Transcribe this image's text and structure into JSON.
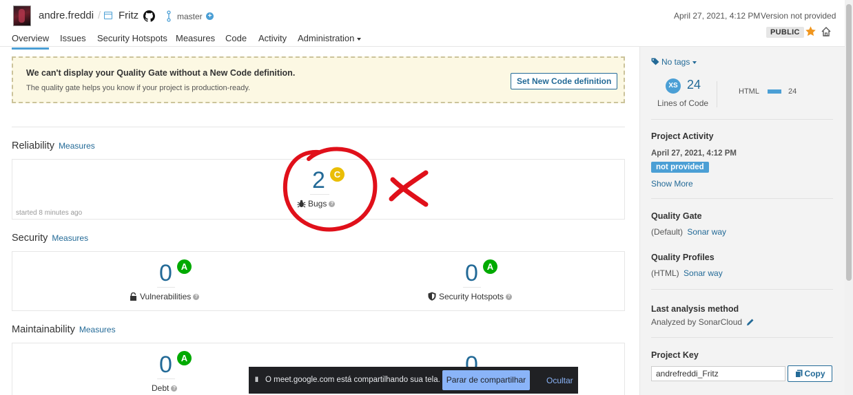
{
  "header": {
    "org": "andre.freddi",
    "separator": "/",
    "project": "Fritz",
    "branch": "master",
    "branch_add": "+",
    "analysis_date": "April 27, 2021, 4:12 PM",
    "version": "Version not provided",
    "visibility": "PUBLIC",
    "nav": [
      {
        "label": "Overview",
        "active": true
      },
      {
        "label": "Issues"
      },
      {
        "label": "Security Hotspots"
      },
      {
        "label": "Measures"
      },
      {
        "label": "Code"
      },
      {
        "label": "Activity"
      },
      {
        "label": "Administration"
      }
    ]
  },
  "quality_gate_notice": {
    "title": "We can't display your Quality Gate without a New Code definition.",
    "subtitle": "The quality gate helps you know if your project is production-ready.",
    "button": "Set New Code definition"
  },
  "reliability": {
    "title": "Reliability",
    "link": "Measures",
    "bugs_value": "2",
    "bugs_grade": "C",
    "bugs_label": "Bugs",
    "started": "started 8 minutes ago"
  },
  "security": {
    "title": "Security",
    "link": "Measures",
    "vulnerabilities_value": "0",
    "vulnerabilities_grade": "A",
    "vulnerabilities_label": "Vulnerabilities",
    "hotspots_value": "0",
    "hotspots_grade": "A",
    "hotspots_label": "Security Hotspots"
  },
  "maintainability": {
    "title": "Maintainability",
    "link": "Measures",
    "debt_value": "0",
    "debt_grade": "A",
    "debt_label": "Debt",
    "smells_value": "0"
  },
  "sidebar": {
    "tags": "No tags",
    "size_badge": "XS",
    "lines_of_code_value": "24",
    "lines_of_code_label": "Lines of Code",
    "language": "HTML",
    "language_lines": "24",
    "activity_title": "Project Activity",
    "activity_date": "April 27, 2021, 4:12 PM",
    "activity_version": "not provided",
    "show_more": "Show More",
    "quality_gate_title": "Quality Gate",
    "quality_gate_default": "(Default)",
    "quality_gate_name": "Sonar way",
    "quality_profiles_title": "Quality Profiles",
    "quality_profiles_lang": "(HTML)",
    "quality_profiles_name": "Sonar way",
    "analysis_method_title": "Last analysis method",
    "analysis_method_value": "Analyzed by SonarCloud",
    "project_key_title": "Project Key",
    "project_key_value": "andrefreddi_Fritz",
    "copy_button": "Copy"
  },
  "meet_bar": {
    "pause": "II",
    "message": "O meet.google.com está compartilhando sua tela.",
    "stop_button": "Parar de compartilhar",
    "hide_button": "Ocultar"
  },
  "colors": {
    "accent": "#4b9fd5",
    "link": "#236a97",
    "grade_a": "#00aa00",
    "grade_c": "#eabe06",
    "warning_bg": "#fcf8e3",
    "annotation_red": "#e0101a"
  }
}
